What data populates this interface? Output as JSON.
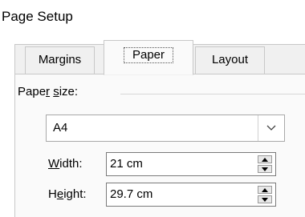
{
  "dialog": {
    "title": "Page Setup"
  },
  "tabs": [
    {
      "label": "Margins",
      "selected": false
    },
    {
      "label": "Paper",
      "selected": true
    },
    {
      "label": "Layout",
      "selected": false
    }
  ],
  "paper_size": {
    "group_label_pre": "Pape",
    "group_label_key": "r",
    "group_label_mid": " ",
    "group_label_key2": "s",
    "group_label_post": "ize:",
    "selected": "A4"
  },
  "width": {
    "label_key": "W",
    "label_rest": "idth:",
    "value": "21 cm"
  },
  "height": {
    "label_pre": "H",
    "label_key": "e",
    "label_rest": "ight:",
    "value": "29.7 cm"
  },
  "icons": {
    "dropdown": "chevron-down-icon",
    "spin_up": "triangle-up-icon",
    "spin_down": "triangle-down-icon"
  }
}
